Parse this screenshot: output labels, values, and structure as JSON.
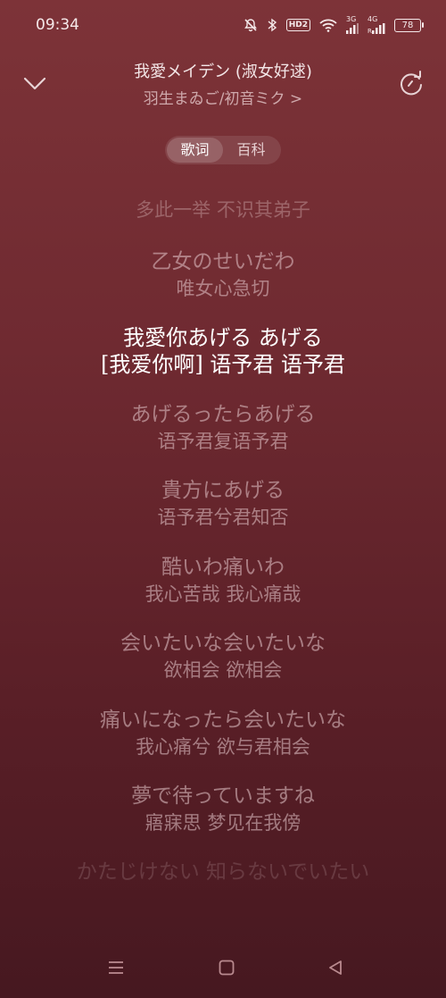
{
  "status_bar": {
    "time": "09:34",
    "hd_badge": "HD2",
    "signal1_label": "3G",
    "signal2_label": "4G",
    "signal2_sub": "R",
    "battery": "78",
    "icons": [
      "mute-icon",
      "bluetooth-icon",
      "hd-icon",
      "wifi-icon",
      "signal-icon",
      "signal-icon",
      "battery-icon"
    ]
  },
  "header": {
    "title": "我愛メイデン (淑女好逑)",
    "artist": "羽生まゐご/初音ミク >",
    "left_icon": "chevron-down-icon",
    "right_icon": "refresh-icon"
  },
  "tabs": [
    {
      "label": "歌词",
      "active": true
    },
    {
      "label": "百科",
      "active": false
    }
  ],
  "lyrics": [
    {
      "jp": "",
      "zh": "多此一举  不识其弟子",
      "style": "faded-top"
    },
    {
      "jp": "乙女のせいだわ",
      "zh": "唯女心急切",
      "style": "dim"
    },
    {
      "jp": "我愛你あげる  あげる",
      "zh": "[我爱你啊]  语予君  语予君",
      "style": "active"
    },
    {
      "jp": "あげるったらあげる",
      "zh": "语予君复语予君",
      "style": "dim"
    },
    {
      "jp": "貴方にあげる",
      "zh": "语予君兮君知否",
      "style": "dim"
    },
    {
      "jp": "酷いわ痛いわ",
      "zh": "我心苦哉  我心痛哉",
      "style": "dim"
    },
    {
      "jp": "会いたいな会いたいな",
      "zh": "欲相会  欲相会",
      "style": "dim"
    },
    {
      "jp": "痛いになったら会いたいな",
      "zh": "我心痛兮  欲与君相会",
      "style": "dim"
    },
    {
      "jp": "夢で待っていますね",
      "zh": "寤寐思  梦见在我傍",
      "style": "dim"
    },
    {
      "jp": "かたじけない  知らないでいたい",
      "zh": "",
      "style": "faded-bottom"
    }
  ],
  "nav_bar": {
    "icons": [
      "menu-icon",
      "home-icon",
      "back-icon"
    ]
  }
}
